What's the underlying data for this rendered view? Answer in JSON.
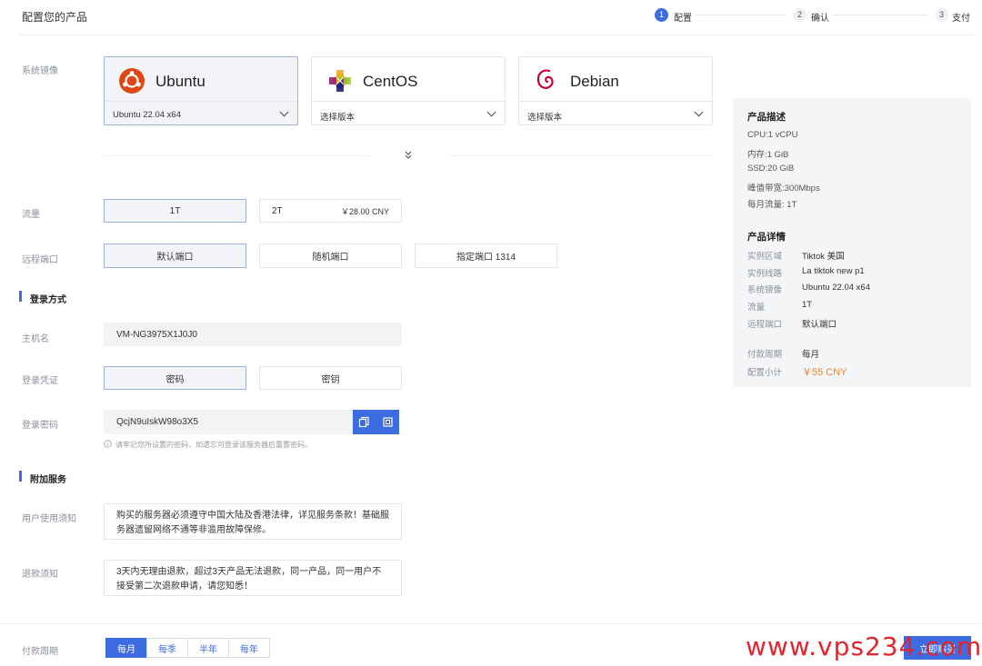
{
  "header": {
    "title": "配置您的产品"
  },
  "steps": [
    {
      "num": "1",
      "label": "配置"
    },
    {
      "num": "2",
      "label": "确认"
    },
    {
      "num": "3",
      "label": "支付"
    }
  ],
  "labels": {
    "os": "系统镜像",
    "traffic": "流量",
    "remote_port": "远程端口",
    "hostname": "主机名",
    "credential": "登录凭证",
    "password": "登录密码",
    "user_notice": "用户使用须知",
    "refund_notice": "退款须知",
    "billing": "付款周期"
  },
  "sections": {
    "login": "登录方式",
    "extra": "附加服务"
  },
  "os_options": [
    {
      "name": "Ubuntu",
      "version": "Ubuntu 22.04 x64"
    },
    {
      "name": "CentOS",
      "version": "选择版本"
    },
    {
      "name": "Debian",
      "version": "选择版本"
    }
  ],
  "traffic": {
    "opt1": "1T",
    "opt2": "2T",
    "opt2_price": "￥28.00 CNY"
  },
  "ports": [
    "默认端口",
    "随机端口",
    "指定端口 1314"
  ],
  "hostname": "VM-NG3975X1J0J0",
  "credentials": [
    "密码",
    "密钥"
  ],
  "password": {
    "value": "QcjN9uIskW98o3X5",
    "hint": "请牢记您所设置的密码，如遗忘可登录该服务器后重置密码。"
  },
  "user_notice": "购买的服务器必须遵守中国大陆及香港法律，详见服务条款！基础服务器遗留网络不通等非滥用故障保修。",
  "refund_notice": "3天内无理由退款，超过3天产品无法退款，同一产品，同一用户不接受第二次退款申请，请您知悉！",
  "panel": {
    "desc_title": "产品描述",
    "desc": [
      "CPU:1 vCPU",
      "内存:1 GiB",
      "SSD:20 GiB",
      "峰值带宽:300Mbps",
      "每月流量: 1T"
    ],
    "detail_title": "产品详情",
    "details": [
      {
        "k": "实例区域",
        "v": "Tiktok 美国"
      },
      {
        "k": "实例线路",
        "v": "La tiktok new p1"
      },
      {
        "k": "系统镜像",
        "v": "Ubuntu 22.04 x64"
      },
      {
        "k": "流量",
        "v": "1T"
      },
      {
        "k": "远程端口",
        "v": "默认端口"
      }
    ],
    "cycle_key": "付款周期",
    "cycle_val": "每月",
    "subtotal_key": "配置小计",
    "subtotal_val": "￥55 CNY"
  },
  "billing": {
    "options": [
      "每月",
      "每季",
      "半年",
      "每年"
    ],
    "active": "每月"
  },
  "watermark": "www.vps234.com",
  "buy_button": "立即购买",
  "colors": {
    "accent": "#3d6ce0",
    "price": "#e8862e",
    "watermark": "#e3242b"
  }
}
